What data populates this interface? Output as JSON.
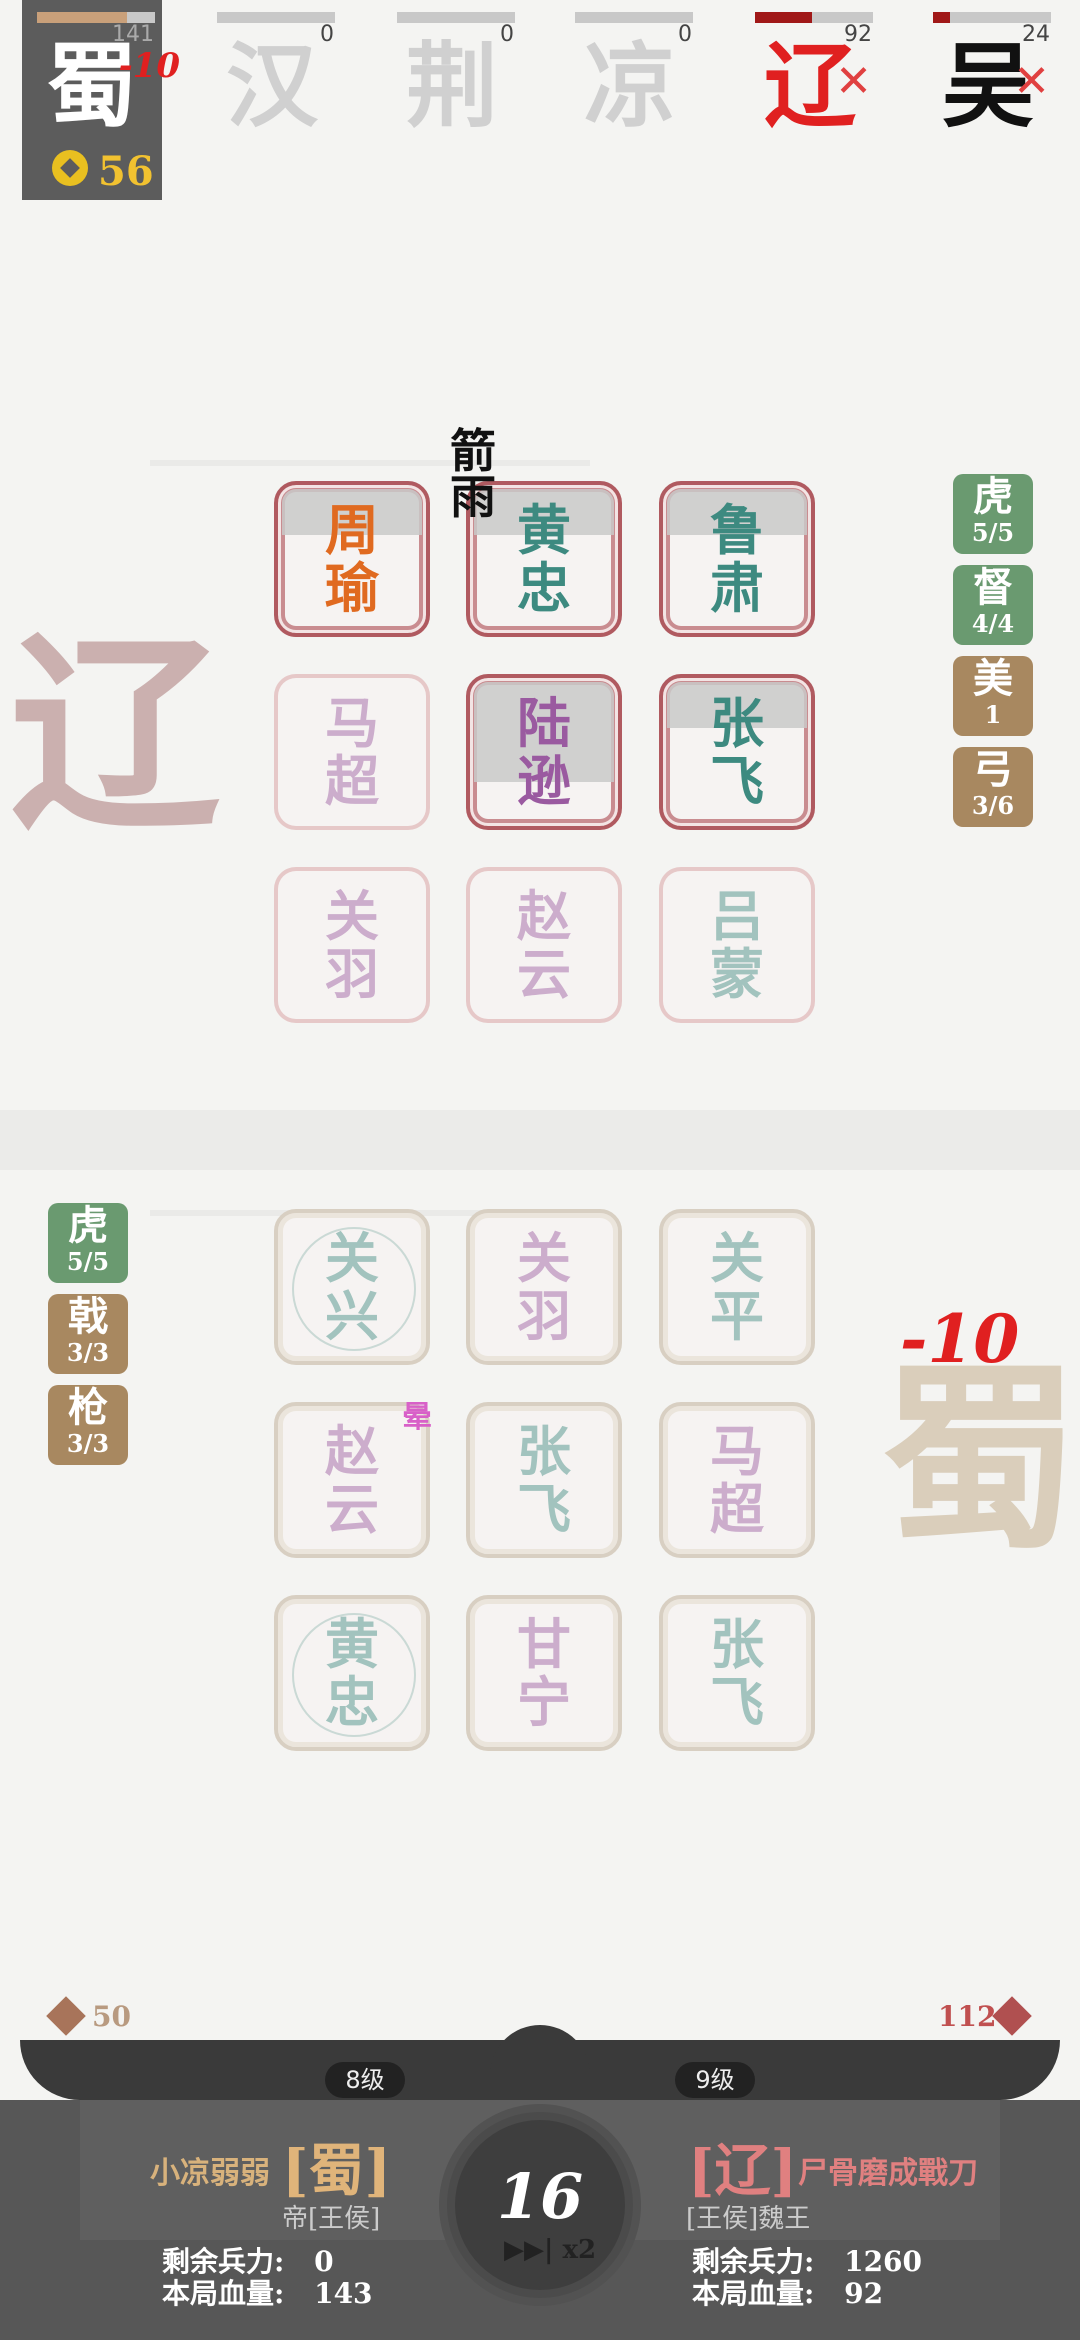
{
  "factions": [
    {
      "char": "蜀",
      "hp": "141",
      "hp_pct": 0.76,
      "active": true,
      "damage": "-10",
      "color": "#ffffff",
      "bar": "#c9a07a"
    },
    {
      "char": "汉",
      "hp": "0",
      "hp_pct": 0,
      "color": "#d0d0d0"
    },
    {
      "char": "荆",
      "hp": "0",
      "hp_pct": 0,
      "color": "#d0d0d0"
    },
    {
      "char": "凉",
      "hp": "0",
      "hp_pct": 0,
      "color": "#d0d0d0"
    },
    {
      "char": "辽",
      "hp": "92",
      "hp_pct": 0.48,
      "color": "#e02020",
      "bar": "#a01818",
      "eliminated": true
    },
    {
      "char": "吴",
      "hp": "24",
      "hp_pct": 0.14,
      "color": "#111111",
      "bar": "#a01818",
      "eliminated": true
    }
  ],
  "gold": "56",
  "enemy_board": [
    {
      "top": "周",
      "bottom": "瑜",
      "color": "orange",
      "state": "active",
      "shade": "light"
    },
    {
      "top": "黄",
      "bottom": "忠",
      "color": "teal",
      "state": "active",
      "shade": "light"
    },
    {
      "top": "鲁",
      "bottom": "肃",
      "color": "teal",
      "state": "active",
      "shade": "light"
    },
    {
      "top": "马",
      "bottom": "超",
      "color": "purple",
      "state": "ghost"
    },
    {
      "top": "陆",
      "bottom": "逊",
      "color": "purple",
      "state": "active",
      "shade": "deep"
    },
    {
      "top": "张",
      "bottom": "飞",
      "color": "teal",
      "state": "active",
      "shade": "light"
    },
    {
      "top": "关",
      "bottom": "羽",
      "color": "purple",
      "state": "ghost"
    },
    {
      "top": "赵",
      "bottom": "云",
      "color": "purple",
      "state": "ghost"
    },
    {
      "top": "吕",
      "bottom": "蒙",
      "color": "teal",
      "state": "ghost"
    }
  ],
  "player_board": [
    {
      "top": "关",
      "bottom": "兴",
      "color": "teal",
      "ring": true
    },
    {
      "top": "关",
      "bottom": "羽",
      "color": "purple"
    },
    {
      "top": "关",
      "bottom": "平",
      "color": "teal"
    },
    {
      "top": "赵",
      "bottom": "云",
      "color": "purple"
    },
    {
      "top": "张",
      "bottom": "飞",
      "color": "teal"
    },
    {
      "top": "马",
      "bottom": "超",
      "color": "purple"
    },
    {
      "top": "黄",
      "bottom": "忠",
      "color": "teal",
      "ring": true
    },
    {
      "top": "甘",
      "bottom": "宁",
      "color": "purple"
    },
    {
      "top": "张",
      "bottom": "飞",
      "color": "teal"
    }
  ],
  "effects": {
    "arrow_rain_top": "箭",
    "arrow_rain_bottom": "雨",
    "stun": "晕",
    "player_damage": "-10"
  },
  "enemy_badges": [
    {
      "label": "虎",
      "value": "5/5",
      "tone": "green"
    },
    {
      "label": "督",
      "value": "4/4",
      "tone": "green"
    },
    {
      "label": "美",
      "value": "1",
      "tone": "brown"
    },
    {
      "label": "弓",
      "value": "3/6",
      "tone": "brown"
    }
  ],
  "player_badges": [
    {
      "label": "虎",
      "value": "5/5",
      "tone": "green"
    },
    {
      "label": "戟",
      "value": "3/3",
      "tone": "brown"
    },
    {
      "label": "枪",
      "value": "3/3",
      "tone": "brown"
    }
  ],
  "enemy_big_char": "辽",
  "player_big_char": "蜀",
  "scores": {
    "left": "50",
    "right": "112"
  },
  "levels": {
    "left": "8级",
    "right": "9级"
  },
  "player": {
    "name": "小凉弱弱",
    "faction": "[蜀]",
    "title": "帝[王侯]",
    "troops_label": "剩余兵力:",
    "troops": "0",
    "hp_label": "本局血量:",
    "hp": "143"
  },
  "opponent": {
    "name": "尸骨磨成戰刀",
    "faction": "[辽]",
    "title": "[王侯]魏王",
    "troops_label": "剩余兵力:",
    "troops": "1260",
    "hp_label": "本局血量:",
    "hp": "92"
  },
  "turn": "16",
  "speed": "▶▶| x2",
  "colors": {
    "orange": "#e06a20",
    "teal": "#3d8a80",
    "purple": "#9a5aa0",
    "gold": "#f2c230",
    "red": "#e02020"
  }
}
